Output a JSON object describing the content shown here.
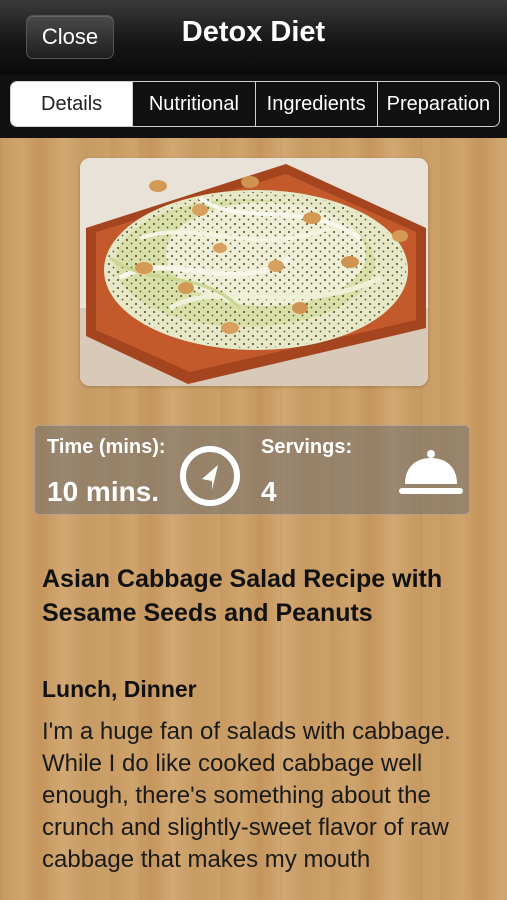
{
  "navbar": {
    "close_label": "Close",
    "title": "Detox Diet"
  },
  "tabs": [
    {
      "label": "Details",
      "active": true
    },
    {
      "label": "Nutritional",
      "active": false
    },
    {
      "label": "Ingredients",
      "active": false
    },
    {
      "label": "Preparation",
      "active": false
    }
  ],
  "info": {
    "time_label": "Time (mins):",
    "time_value": "10 mins.",
    "time_icon": "timer-icon",
    "servings_label": "Servings:",
    "servings_value": "4",
    "servings_icon": "serving-cloche-icon"
  },
  "recipe": {
    "title": "Asian Cabbage Salad Recipe with Sesame Seeds and Peanuts",
    "meal_types": "Lunch, Dinner",
    "description": "I'm a huge fan of salads with cabbage. While I do like cooked cabbage well enough, there's something about the crunch and slightly-sweet flavor of raw cabbage that makes my mouth"
  },
  "colors": {
    "navbar": "#141414",
    "wood": "#c89a62",
    "active_tab_bg": "#ffffff",
    "text": "#111111"
  }
}
